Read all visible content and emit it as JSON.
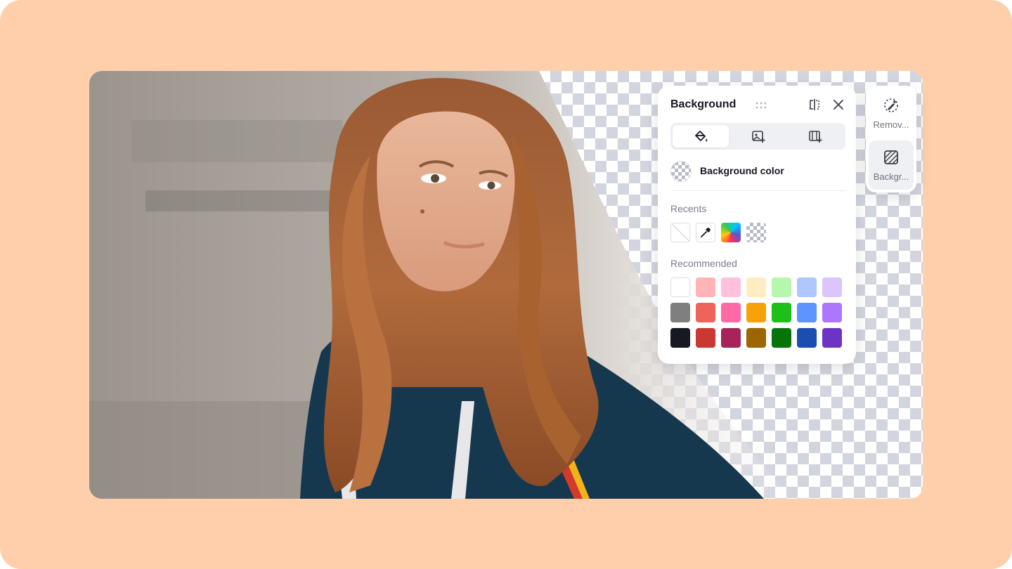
{
  "panel": {
    "title": "Background",
    "tabs": [
      {
        "icon": "paint-bucket-icon"
      },
      {
        "icon": "add-image-icon"
      },
      {
        "icon": "add-video-icon"
      }
    ],
    "bg_color_label": "Background color",
    "recents_label": "Recents",
    "recommended_label": "Recommended",
    "recents": [
      "none",
      "color-picker",
      "gradient",
      "transparent"
    ],
    "recommended": [
      [
        "#ffffff",
        "#ffb5b5",
        "#ffc1dc",
        "#ffecc1",
        "#b4f7ad",
        "#afc7ff",
        "#dcc5ff"
      ],
      [
        "#7f7f7f",
        "#f0635a",
        "#ff69a5",
        "#f8a20a",
        "#1fbf1a",
        "#5e94ff",
        "#ad76ff"
      ],
      [
        "#161822",
        "#cb3832",
        "#a6245a",
        "#9d6500",
        "#067509",
        "#1b4eb1",
        "#6d34c4"
      ]
    ]
  },
  "toolbar": {
    "items": [
      {
        "label": "Remov...",
        "icon": "remove-background-icon"
      },
      {
        "label": "Backgr...",
        "icon": "background-icon"
      }
    ]
  },
  "colors": {
    "frame": "#ffcfab",
    "text_primary": "#161822",
    "text_secondary": "#7a7e89"
  }
}
